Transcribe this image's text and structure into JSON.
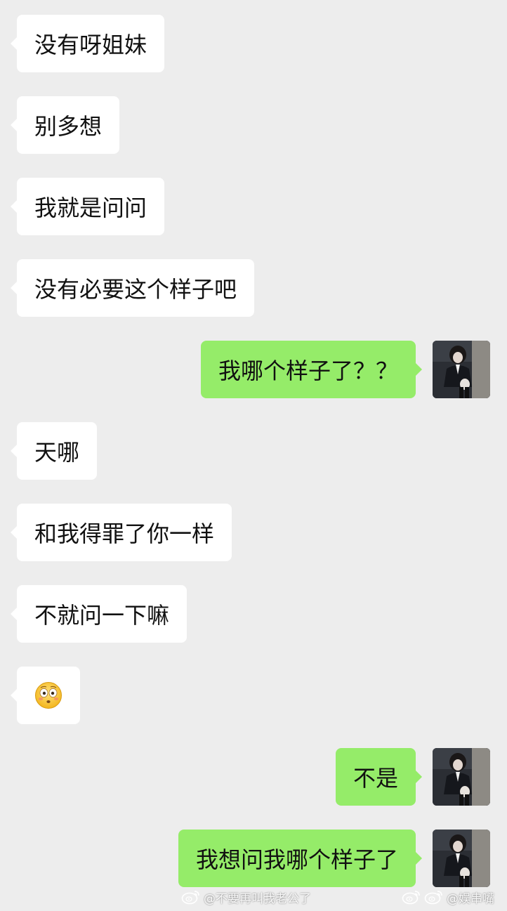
{
  "messages": [
    {
      "side": "in",
      "text": "没有呀姐妹"
    },
    {
      "side": "in",
      "text": "别多想"
    },
    {
      "side": "in",
      "text": "我就是问问"
    },
    {
      "side": "in",
      "text": "没有必要这个样子吧"
    },
    {
      "side": "out",
      "text": "我哪个样子了？？"
    },
    {
      "side": "in",
      "text": "天哪"
    },
    {
      "side": "in",
      "text": "和我得罪了你一样"
    },
    {
      "side": "in",
      "text": "不就问一下嘛"
    },
    {
      "side": "in",
      "emoji": "flushed-face"
    },
    {
      "side": "out",
      "text": "不是"
    },
    {
      "side": "out",
      "text": "我想问我哪个样子了"
    }
  ],
  "watermarks": {
    "left": "@不要再叫我老公了",
    "right": "@娱串嘴"
  },
  "colors": {
    "background": "#ededed",
    "incoming_bubble": "#ffffff",
    "outgoing_bubble": "#95ec69"
  }
}
